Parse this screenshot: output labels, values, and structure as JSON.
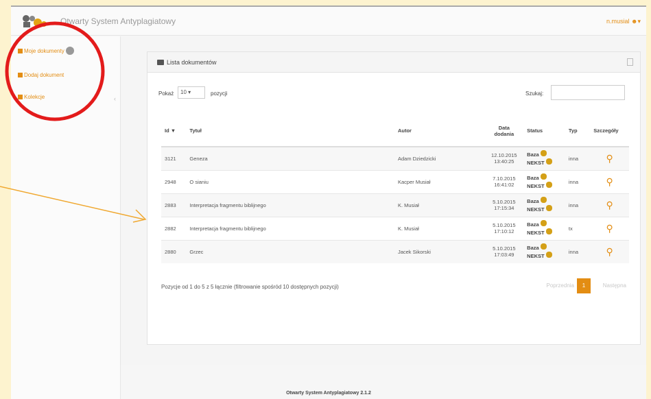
{
  "app": {
    "title": "Otwarty System Antyplagiatowy",
    "user": "n.musial"
  },
  "sidebar": {
    "items": [
      {
        "label": "Moje dokumenty"
      },
      {
        "label": "Dodaj dokument"
      },
      {
        "label": "Kolekcje"
      }
    ]
  },
  "panel": {
    "title": "Lista dokumentów"
  },
  "controls": {
    "show_label": "Pokaż",
    "page_size": "10",
    "per_page_label": "pozycji",
    "search_label": "Szukaj:"
  },
  "table": {
    "headers": [
      "Id",
      "Tytuł",
      "Autor",
      "Data dodania",
      "Status",
      "Typ",
      "Szczegóły"
    ],
    "rows": [
      {
        "id": "3121",
        "title": "Geneza",
        "author": "Adam Dziedzicki",
        "date": "12.10.2015",
        "time": "13:40:25",
        "status1": "Baza",
        "status2": "NEKST",
        "type": "inna"
      },
      {
        "id": "2948",
        "title": "O sianiu",
        "author": "Kacper Musiał",
        "date": "7.10.2015",
        "time": "16:41:02",
        "status1": "Baza",
        "status2": "NEKST",
        "type": "inna"
      },
      {
        "id": "2883",
        "title": "Interpretacja fragmentu biblijnego",
        "author": "K. Musiał",
        "date": "5.10.2015",
        "time": "17:15:34",
        "status1": "Baza",
        "status2": "NEKST",
        "type": "inna"
      },
      {
        "id": "2882",
        "title": "Interpretacja fragmentu biblijnego",
        "author": "K. Musiał",
        "date": "5.10.2015",
        "time": "17:10:12",
        "status1": "Baza",
        "status2": "NEKST",
        "type": "tx"
      },
      {
        "id": "2880",
        "title": "Grzeс",
        "author": "Jacek Sikorski",
        "date": "5.10.2015",
        "time": "17:03:49",
        "status1": "Baza",
        "status2": "NEKST",
        "type": "inna"
      }
    ]
  },
  "info": "Pozycje od 1 do 5 z 5 łącznie (filtrowanie spośród 10 dostępnych pozycji)",
  "pagination": {
    "prev": "Poprzednia",
    "current": "1",
    "next": "Następna"
  },
  "footer": "Otwarty System Antyplagiatowy 2.1.2",
  "colors": {
    "accent": "#e38d13",
    "annotation_circle": "#e31b1b",
    "annotation_arrow": "#f0a830"
  }
}
